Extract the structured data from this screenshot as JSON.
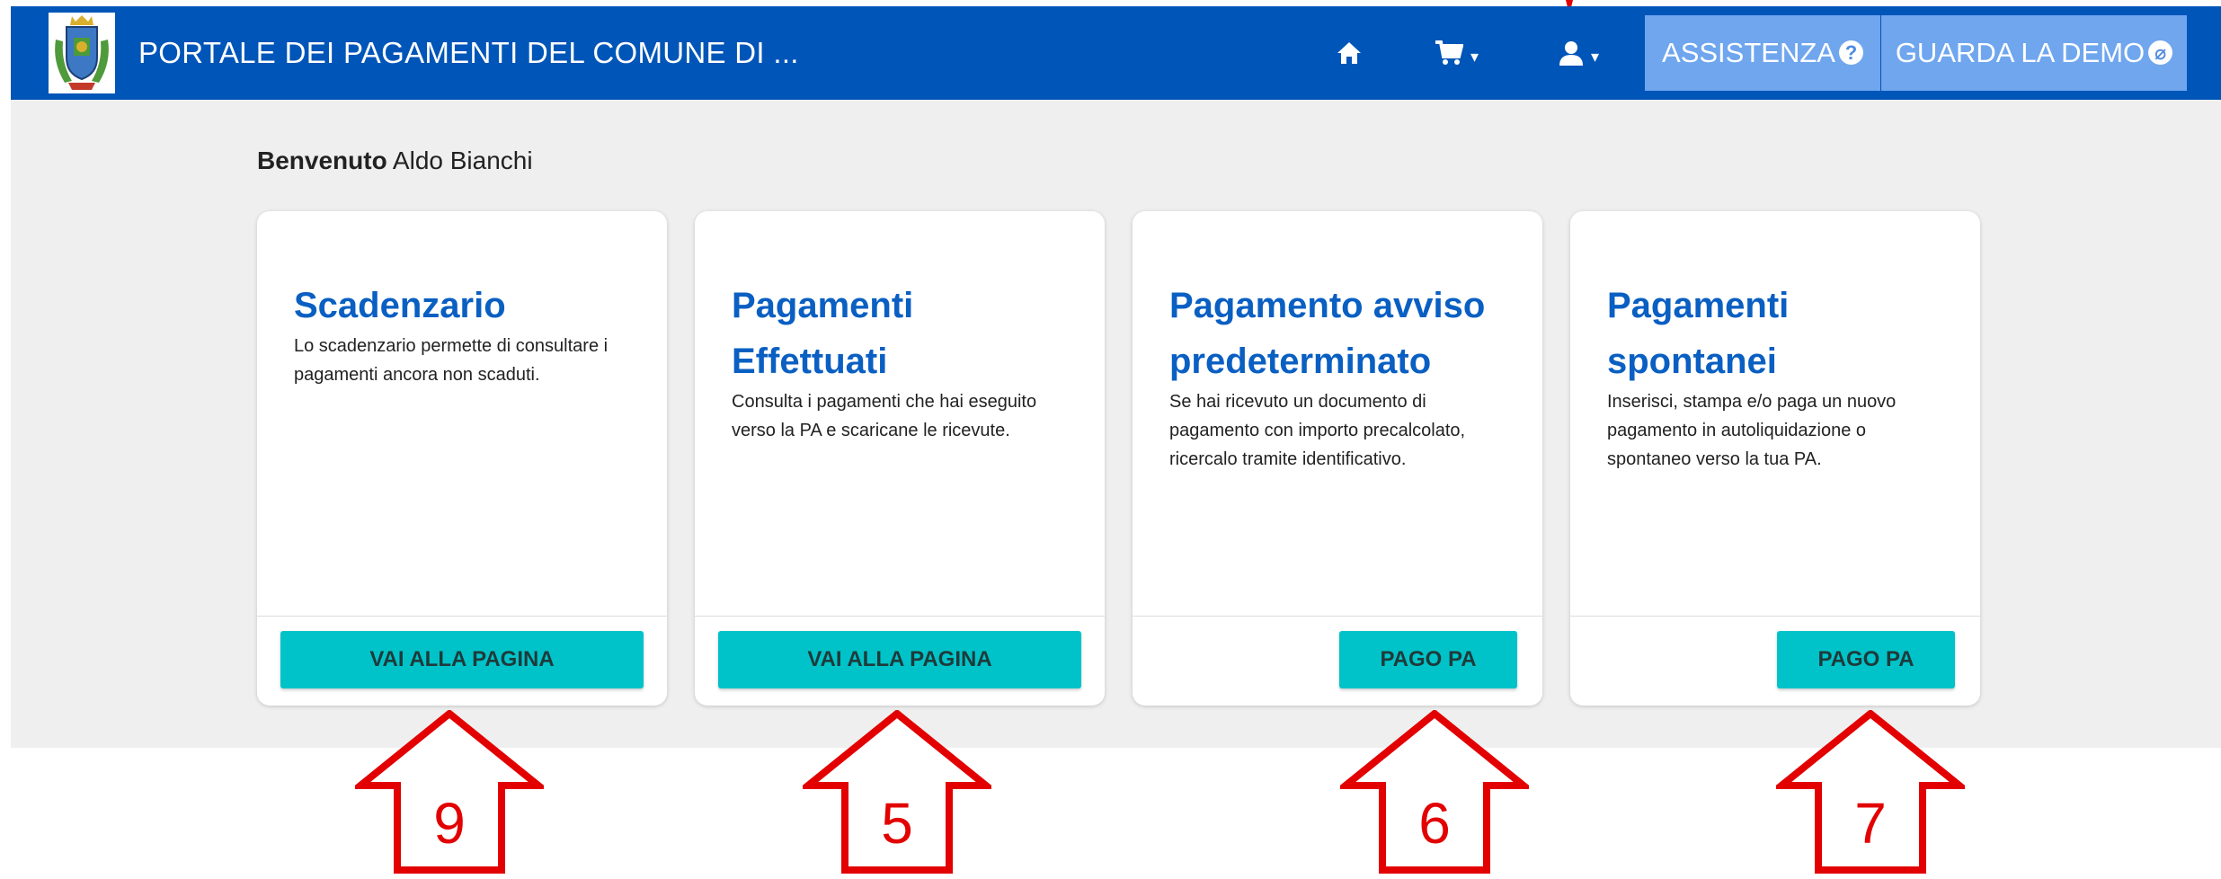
{
  "header": {
    "title": "PORTALE DEI PAGAMENTI DEL COMUNE DI ...",
    "logo_icon": "coat-of-arms-icon",
    "icons": [
      "home-icon",
      "cart-icon",
      "user-icon"
    ],
    "assistance_label": "ASSISTENZA",
    "demo_label": "GUARDA LA DEMO",
    "color": "#0055b8",
    "button_color": "#6fa6ee"
  },
  "welcome": {
    "prefix": "Benvenuto",
    "name": "Aldo Bianchi"
  },
  "cards": [
    {
      "title": "Scadenzario",
      "description": "Lo scadenzario permette di consultare i pagamenti ancora non scaduti.",
      "button": "VAI ALLA PAGINA"
    },
    {
      "title": "Pagamenti Effettuati",
      "description": "Consulta i pagamenti che hai eseguito verso la PA e scaricane le ricevute.",
      "button": "VAI ALLA PAGINA"
    },
    {
      "title": "Pagamento avviso predeterminato",
      "description": "Se hai ricevuto un documento di pagamento con importo precalcolato, ricercalo tramite identificativo.",
      "button": "PAGO PA"
    },
    {
      "title": "Pagamenti spontanei",
      "description": "Inserisci, stampa e/o paga un nuovo pagamento in autoliquidazione o spontaneo verso la tua PA.",
      "button": "PAGO PA"
    }
  ],
  "annotations": [
    "9",
    "5",
    "6",
    "7"
  ],
  "colors": {
    "card_title": "#0a5fc2",
    "button": "#00c3c9",
    "annotation": "#e20000"
  }
}
